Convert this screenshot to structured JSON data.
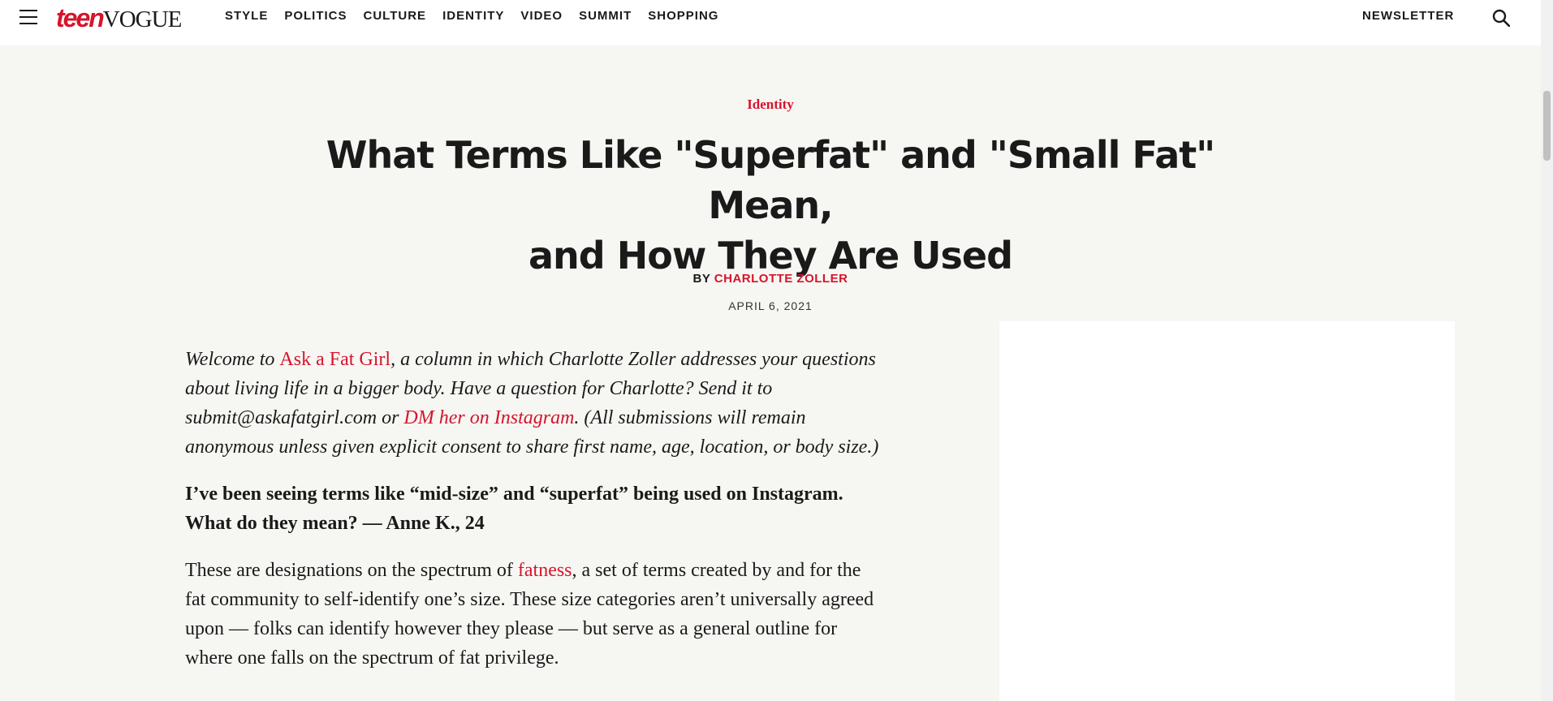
{
  "header": {
    "logo_teen": "teen",
    "logo_vogue": "VOGUE",
    "nav": [
      "STYLE",
      "POLITICS",
      "CULTURE",
      "IDENTITY",
      "VIDEO",
      "SUMMIT",
      "SHOPPING"
    ],
    "newsletter": "NEWSLETTER"
  },
  "colors": {
    "accent": "#d6142b",
    "background": "#f6f6f3",
    "text": "#1a1a1a"
  },
  "article": {
    "rubric": "Identity",
    "title_line1": "What Terms Like \"Superfat\" and \"Small Fat\" Mean,",
    "title_line2": "and How They Are Used",
    "byline_prefix": "BY ",
    "author": "CHARLOTTE ZOLLER",
    "date": "APRIL 6, 2021",
    "intro": {
      "t1": "Welcome to ",
      "link1": "Ask a Fat Girl",
      "t2": ", a column in which Charlotte Zoller addresses your questions about living life in a bigger body. Have a question for Charlotte? Send it to submit@askafatgirl.com or ",
      "link2": "DM her on Instagram",
      "t3": ". (All submissions will remain anonymous unless given explicit consent to share first name, age, location, or body size.)"
    },
    "question": "I’ve been seeing terms like “mid-size” and “superfat” being used on Instagram. What do they mean? — Anne K., 24",
    "body": {
      "t1": "These are designations on the spectrum of ",
      "link": "fatness",
      "t2": ", a set of terms created by and for the fat community to self-identify one’s size. These size categories aren’t universally agreed upon — folks can identify however they please — but serve as a general outline for where one falls on the spectrum of fat privilege."
    }
  }
}
